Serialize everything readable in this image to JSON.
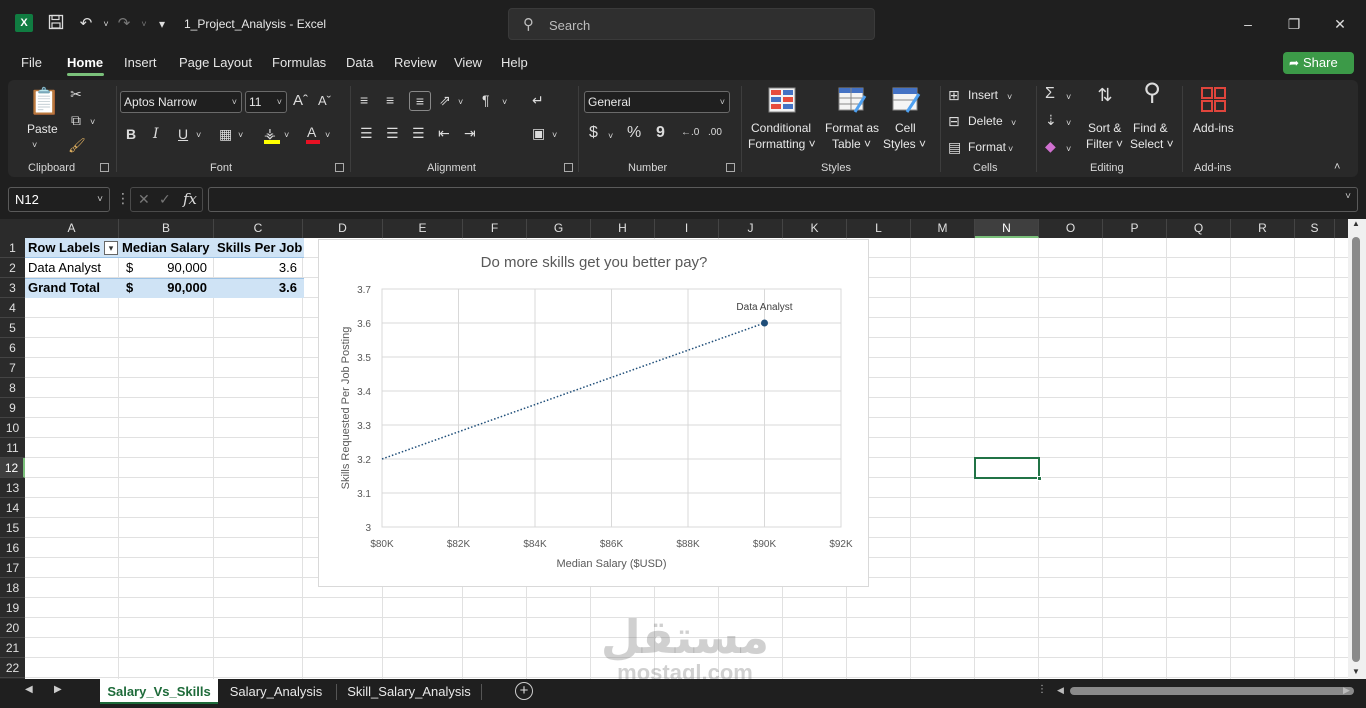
{
  "window": {
    "title": "1_Project_Analysis  -  Excel",
    "search_placeholder": "Search",
    "app_logo": "X"
  },
  "menu": {
    "tabs": [
      "File",
      "Home",
      "Insert",
      "Page Layout",
      "Formulas",
      "Data",
      "Review",
      "View",
      "Help"
    ],
    "active": "Home",
    "share_label": "Share"
  },
  "ribbon": {
    "clipboard": {
      "label": "Clipboard",
      "paste": "Paste"
    },
    "font": {
      "label": "Font",
      "name": "Aptos Narrow",
      "size": "11",
      "bold": "B",
      "italic": "I",
      "underline": "U"
    },
    "alignment": {
      "label": "Alignment"
    },
    "number": {
      "label": "Number",
      "format": "General",
      "currency": "$",
      "percent": "%",
      "comma": "9"
    },
    "styles": {
      "label": "Styles",
      "conditional": [
        "Conditional",
        "Formatting ˅"
      ],
      "format_table": [
        "Format as",
        "Table ˅"
      ],
      "cell_styles": [
        "Cell",
        "Styles ˅"
      ]
    },
    "cells": {
      "label": "Cells",
      "insert": "Insert",
      "delete": "Delete",
      "format": "Format"
    },
    "editing": {
      "label": "Editing",
      "sort": [
        "Sort &",
        "Filter ˅"
      ],
      "find": [
        "Find &",
        "Select ˅"
      ]
    },
    "addins": {
      "label": "Add-ins",
      "button": "Add-ins"
    }
  },
  "formula_bar": {
    "name_box": "N12",
    "fx": "fx",
    "value": ""
  },
  "columns": [
    "A",
    "B",
    "C",
    "D",
    "E",
    "F",
    "G",
    "H",
    "I",
    "J",
    "K",
    "L",
    "M",
    "N",
    "O",
    "P",
    "Q",
    "R",
    "S"
  ],
  "rows": [
    "1",
    "2",
    "3",
    "4",
    "5",
    "6",
    "7",
    "8",
    "9",
    "10",
    "11",
    "12",
    "13",
    "14",
    "15",
    "16",
    "17",
    "18",
    "19",
    "20",
    "21",
    "22"
  ],
  "selected_cell": "N12",
  "table": {
    "headers": [
      "Row Labels",
      "Median Salary",
      "Skills Per Job"
    ],
    "rows": [
      {
        "label": "Data Analyst",
        "currency": "$",
        "salary": "90,000",
        "skills": "3.6"
      }
    ],
    "total": {
      "label": "Grand Total",
      "currency": "$",
      "salary": "90,000",
      "skills": "3.6"
    }
  },
  "chart_data": {
    "type": "scatter",
    "title": "Do more skills get you better pay?",
    "xlabel": "Median Salary ($USD)",
    "ylabel": "Skills Requested Per Job Posting",
    "xlim": [
      80000,
      92000
    ],
    "ylim": [
      3,
      3.7
    ],
    "x_ticks": [
      "$80K",
      "$82K",
      "$84K",
      "$86K",
      "$88K",
      "$90K",
      "$92K"
    ],
    "y_ticks": [
      "3",
      "3.1",
      "3.2",
      "3.3",
      "3.4",
      "3.5",
      "3.6",
      "3.7"
    ],
    "points": [
      {
        "x": 90000,
        "y": 3.6,
        "label": "Data Analyst"
      }
    ],
    "trendline": {
      "from": [
        80000,
        3.2
      ],
      "to": [
        90000,
        3.6
      ],
      "style": "dotted"
    },
    "grid": true,
    "legend": "none",
    "color": "#1f4e79"
  },
  "sheets": [
    "Salary_Vs_Skills",
    "Salary_Analysis",
    "Skill_Salary_Analysis"
  ],
  "active_sheet": "Salary_Vs_Skills",
  "watermark": [
    "مستقل",
    "mostaql.com"
  ]
}
